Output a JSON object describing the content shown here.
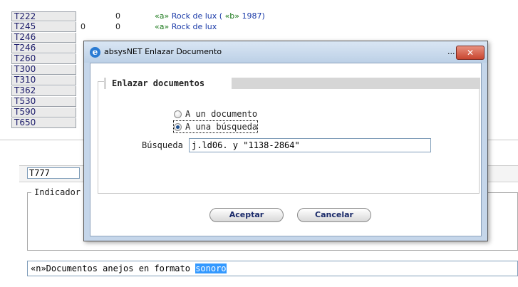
{
  "grid": {
    "rows": [
      {
        "tag": "T222",
        "ind1": "",
        "ind2": "0",
        "code": "«a»",
        "text": " Rock de lux ( ",
        "code2": "«b»",
        "text2": " 1987)"
      },
      {
        "tag": "T245",
        "ind1": "0",
        "ind2": "0",
        "code": "«a»",
        "text": " Rock de lux",
        "code2": "",
        "text2": ""
      },
      {
        "tag": "T246",
        "ind1": "",
        "ind2": "",
        "code": "",
        "text": "",
        "code2": "",
        "text2": ""
      },
      {
        "tag": "T246",
        "ind1": "",
        "ind2": "",
        "code": "",
        "text": "",
        "code2": "",
        "text2": ""
      },
      {
        "tag": "T260",
        "ind1": "",
        "ind2": "",
        "code": "",
        "text": "",
        "code2": "",
        "text2": ""
      },
      {
        "tag": "T300",
        "ind1": "",
        "ind2": "",
        "code": "",
        "text": "",
        "code2": "",
        "text2": ""
      },
      {
        "tag": "T310",
        "ind1": "",
        "ind2": "",
        "code": "",
        "text": "",
        "code2": "",
        "text2": ""
      },
      {
        "tag": "T362",
        "ind1": "",
        "ind2": "",
        "code": "",
        "text": "",
        "code2": "",
        "text2": ""
      },
      {
        "tag": "T530",
        "ind1": "",
        "ind2": "",
        "code": "",
        "text": "",
        "code2": "",
        "text2": ""
      },
      {
        "tag": "T590",
        "ind1": "",
        "ind2": "",
        "code": "",
        "text": "",
        "code2": "",
        "text2": ""
      },
      {
        "tag": "T650",
        "ind1": "",
        "ind2": "",
        "code": "",
        "text": "",
        "code2": "",
        "text2": ""
      }
    ]
  },
  "editor": {
    "tag_value": "T777",
    "indicators_legend": "Indicador",
    "field_text": "«n»Documentos anejos en formato ",
    "field_selected": "sonoro"
  },
  "dialog": {
    "title": "absysNET Enlazar Documento",
    "title_dots": "...",
    "close_glyph": "✕",
    "section_title": "Enlazar documentos",
    "radio_one_label": "A un documento",
    "radio_two_label": "A una búsqueda",
    "radio_selected": "A una búsqueda",
    "search_label": "Búsqueda",
    "search_value": "j.ld06. y \"1138-2864\"",
    "accept_label": "Aceptar",
    "cancel_label": "Cancelar"
  },
  "colors": {
    "subfield_code": "#1d7a1d",
    "subfield_value": "#1a3aa8",
    "close_button": "#c8452f",
    "selection": "#3399ff"
  },
  "icons": [
    "ie-icon",
    "close-icon"
  ]
}
